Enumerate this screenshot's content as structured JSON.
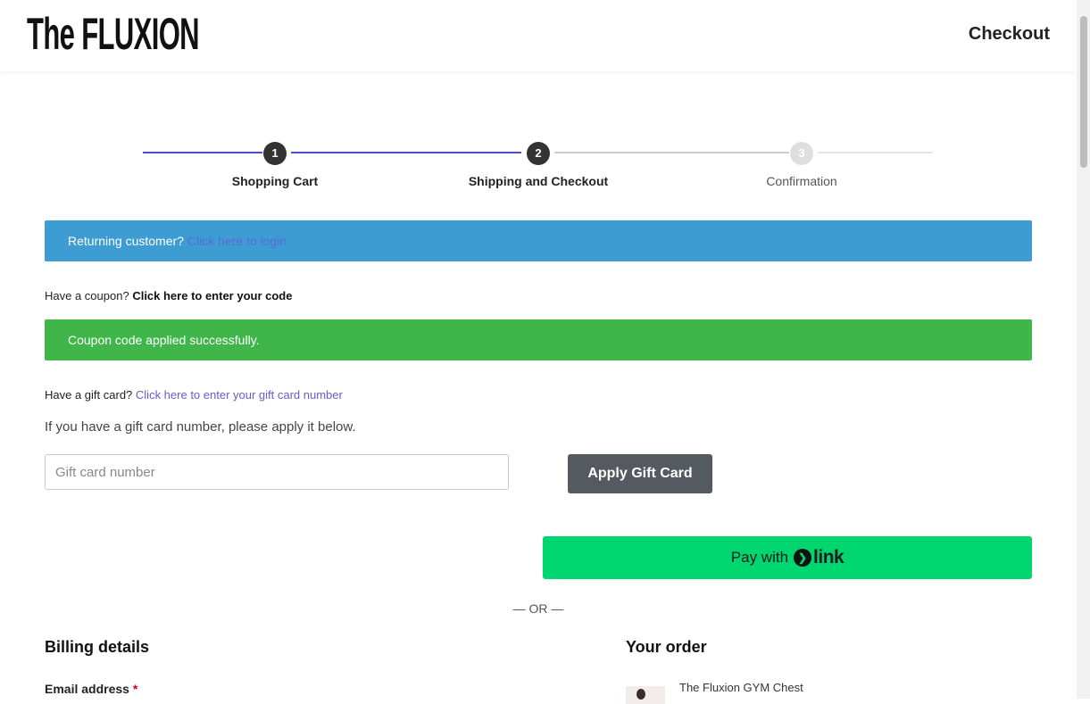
{
  "header": {
    "logo_text": "The FLUXION",
    "title": "Checkout"
  },
  "steps": [
    {
      "number": "1",
      "label": "Shopping Cart",
      "state": "done"
    },
    {
      "number": "2",
      "label": "Shipping and Checkout",
      "state": "active"
    },
    {
      "number": "3",
      "label": "Confirmation",
      "state": "pending"
    }
  ],
  "colors": {
    "progress_active": "#4a4ec9",
    "progress_inactive": "#cccccc",
    "info_notice": "#3d9cd2",
    "success_notice": "#3fb54a",
    "link_button": "#00d66f",
    "apply_button": "#555a60"
  },
  "returning": {
    "text": "Returning customer?",
    "link": "Click here to login"
  },
  "coupon": {
    "text": "Have a coupon?",
    "link": "Click here to enter your code",
    "success": "Coupon code applied successfully."
  },
  "gift": {
    "text": "Have a gift card?",
    "link": "Click here to enter your gift card number",
    "hint": "If you have a gift card number, please apply it below.",
    "placeholder": "Gift card number",
    "button": "Apply Gift Card"
  },
  "link_pay": {
    "pay_with": "Pay with",
    "icon": "chevron-right-icon",
    "brand": "link"
  },
  "or_text": "— OR —",
  "billing": {
    "title": "Billing details",
    "email_label": "Email address",
    "required_mark": "*"
  },
  "order": {
    "title": "Your order",
    "items": [
      {
        "name": "The Fluxion GYM Chest"
      }
    ]
  }
}
